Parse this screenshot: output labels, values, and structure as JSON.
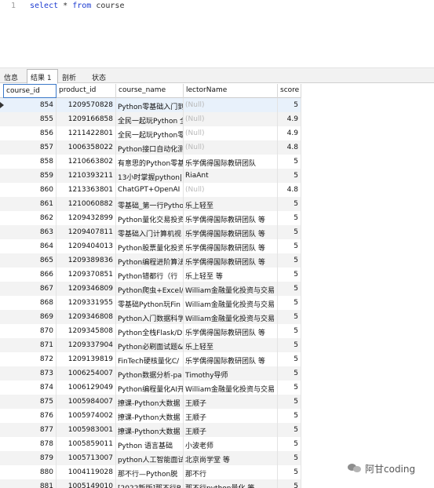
{
  "editor": {
    "line_number": "1",
    "sql": {
      "kw1": "select",
      "star": "*",
      "kw2": "from",
      "table": "course"
    }
  },
  "tabs": [
    {
      "label": "信息"
    },
    {
      "label": "结果 1",
      "active": true
    },
    {
      "label": "剖析"
    },
    {
      "label": "状态"
    }
  ],
  "columns": [
    "course_id",
    "product_id",
    "course_name",
    "lectorName",
    "score"
  ],
  "rows": [
    [
      "854",
      "1209570828",
      "Python零基础入门到",
      "(Null)",
      "5"
    ],
    [
      "855",
      "1209166858",
      "全民一起玩Python 全",
      "(Null)",
      "4.9"
    ],
    [
      "856",
      "1211422801",
      "全民一起玩Python零",
      "(Null)",
      "4.9"
    ],
    [
      "857",
      "1006358022",
      "Python接口自动化测",
      "(Null)",
      "4.8"
    ],
    [
      "858",
      "1210663802",
      "有意思的Python零基",
      "乐学偶得国际教研团队",
      "5"
    ],
    [
      "859",
      "1210393211",
      "13小时掌握python|",
      "RiaAnt",
      "5"
    ],
    [
      "860",
      "1213363801",
      "ChatGPT+OpenAI",
      "(Null)",
      "4.8"
    ],
    [
      "861",
      "1210060882",
      "零基础_第一行Pytho",
      "乐上轻至",
      "5"
    ],
    [
      "862",
      "1209432899",
      "Python量化交易投资",
      "乐学偶得国际教研团队 等",
      "5"
    ],
    [
      "863",
      "1209407811",
      "零基础入门计算机视",
      "乐学偶得国际教研团队 等",
      "5"
    ],
    [
      "864",
      "1209404013",
      "Python股票量化投资",
      "乐学偶得国际教研团队 等",
      "5"
    ],
    [
      "865",
      "1209389836",
      "Python编程进阶算法",
      "乐学偶得国际教研团队 等",
      "5"
    ],
    [
      "866",
      "1209370851",
      "Python错都行（行",
      "乐上轻至 等",
      "5"
    ],
    [
      "867",
      "1209346809",
      "Python爬虫+Excel/",
      "William金融量化投资与交易",
      "5"
    ],
    [
      "868",
      "1209331955",
      "零基础Python玩Fin",
      "William金融量化投资与交易",
      "5"
    ],
    [
      "869",
      "1209346808",
      "Python入门数据科学",
      "William金融量化投资与交易",
      "5"
    ],
    [
      "870",
      "1209345808",
      "Python全栈Flask/D",
      "乐学偶得国际教研团队 等",
      "5"
    ],
    [
      "871",
      "1209337904",
      "Python必刷面试题&",
      "乐上轻至",
      "5"
    ],
    [
      "872",
      "1209139819",
      "FinTech硬核量化C/",
      "乐学偶得国际教研团队 等",
      "5"
    ],
    [
      "873",
      "1006254007",
      "Python数据分析-pa",
      "Timothy导师",
      "5"
    ],
    [
      "874",
      "1006129049",
      "Python编程量化AI开",
      "William金融量化投资与交易",
      "5"
    ],
    [
      "875",
      "1005984007",
      "撩课-Python大数据",
      "王顺子",
      "5"
    ],
    [
      "876",
      "1005974002",
      "撩课-Python大数据",
      "王顺子",
      "5"
    ],
    [
      "877",
      "1005983001",
      "撩课-Python大数据",
      "王顺子",
      "5"
    ],
    [
      "878",
      "1005859011",
      "Python 语言基础",
      "小波老师",
      "5"
    ],
    [
      "879",
      "1005713007",
      "python人工智能面试",
      "北京尚学堂 等",
      "5"
    ],
    [
      "880",
      "1004119028",
      "那不行—Python脱",
      "那不行",
      "5"
    ],
    [
      "881",
      "1005149010",
      "[2022新版]那不行B",
      "那不行python量化 等",
      "5"
    ]
  ],
  "watermark": {
    "text": "阿甘coding",
    "icon": "wechat-icon"
  }
}
